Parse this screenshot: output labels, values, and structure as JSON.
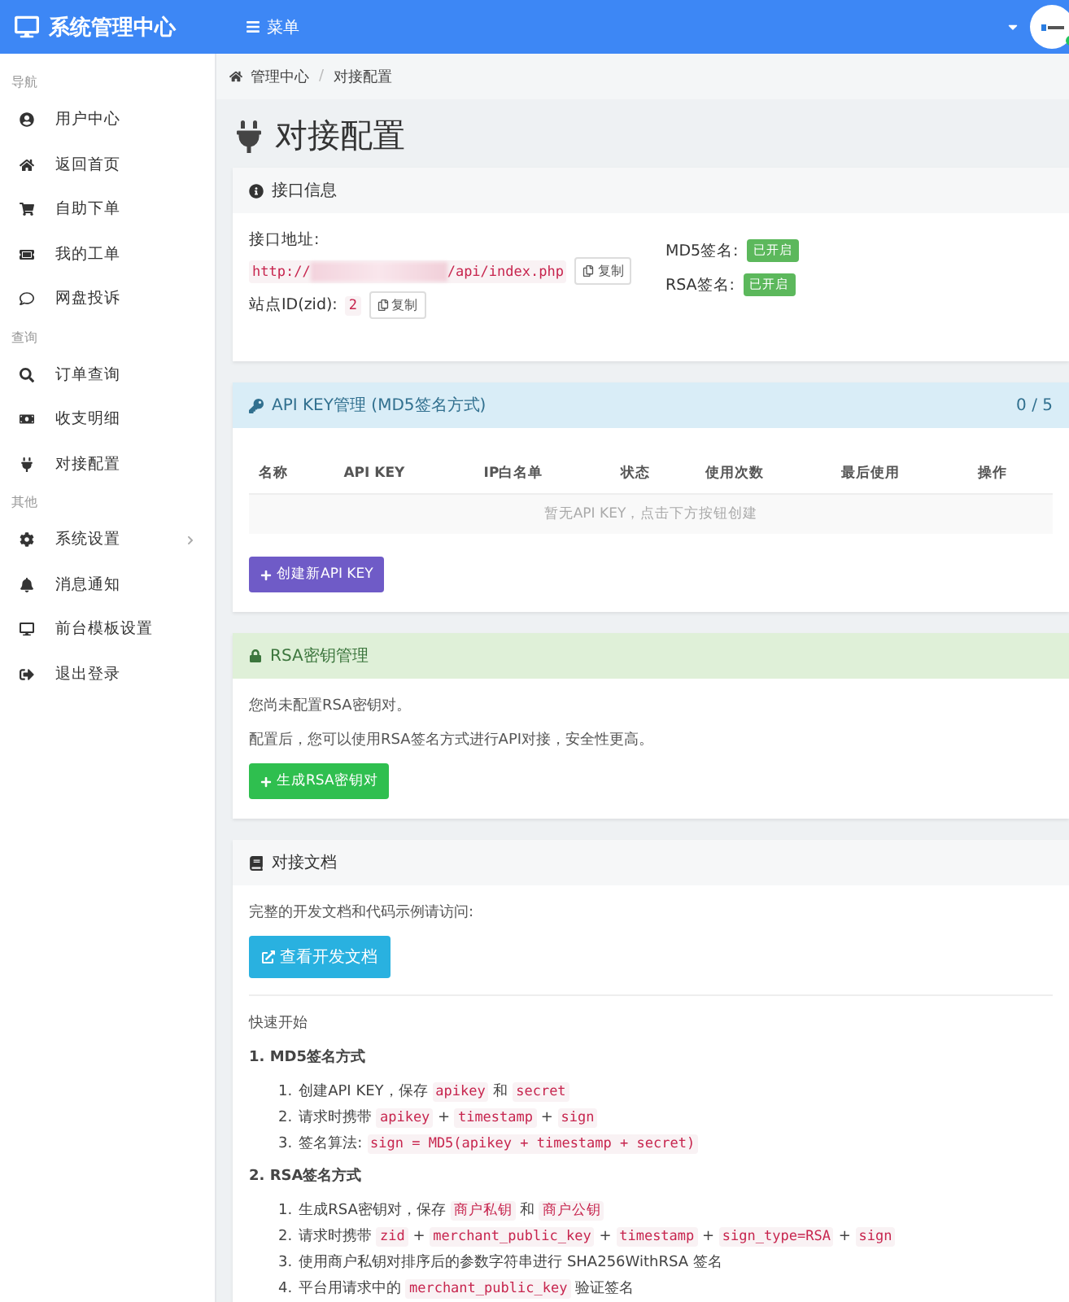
{
  "header": {
    "title": "系统管理中心",
    "menu_label": "菜单",
    "online": true
  },
  "sidebar": {
    "sections": [
      {
        "title": "导航",
        "items": [
          {
            "label": "用户中心"
          },
          {
            "label": "返回首页"
          },
          {
            "label": "自助下单"
          },
          {
            "label": "我的工单"
          },
          {
            "label": "网盘投诉"
          }
        ]
      },
      {
        "title": "查询",
        "items": [
          {
            "label": "订单查询"
          },
          {
            "label": "收支明细"
          },
          {
            "label": "对接配置"
          }
        ]
      },
      {
        "title": "其他",
        "items": [
          {
            "label": "系统设置",
            "expandable": true
          },
          {
            "label": "消息通知"
          },
          {
            "label": "前台模板设置"
          },
          {
            "label": "退出登录"
          }
        ]
      }
    ]
  },
  "breadcrumb": [
    "管理中心",
    "对接配置"
  ],
  "breadcrumb_separator": "/",
  "page_title": "对接配置",
  "interface_info": {
    "title": "接口信息",
    "url_label": "接口地址:",
    "url_prefix": "http://",
    "url_suffix": "/api/index.php",
    "copy_label": "复制",
    "zid_label": "站点ID(zid):",
    "zid": "2",
    "zid_copy_label": "复制",
    "signatures": [
      {
        "label": "MD5签名:",
        "status": "已开启",
        "enabled": true
      },
      {
        "label": "RSA签名:",
        "status": "已开启",
        "enabled": true
      }
    ]
  },
  "api_keys": {
    "title": "API KEY管理 (MD5签名方式)",
    "count": "0 / 5",
    "columns": [
      "名称",
      "API KEY",
      "IP白名单",
      "状态",
      "使用次数",
      "最后使用",
      "操作"
    ],
    "empty_message": "暂无API KEY，点击下方按钮创建",
    "button": "创建新API KEY"
  },
  "rsa": {
    "title": "RSA密钥管理",
    "lines": [
      "您尚未配置RSA密钥对。",
      "配置后，您可以使用RSA签名方式进行API对接，安全性更高。"
    ],
    "button": "生成RSA密钥对"
  },
  "docs": {
    "title": "对接文档",
    "intro": "完整的开发文档和代码示例请访问:",
    "button": "查看开发文档",
    "quick_start": "快速开始",
    "methods": [
      {
        "title": "1. MD5签名方式",
        "steps": [
          {
            "number": "1.",
            "parts": [
              {
                "text": "创建API KEY，保存 "
              },
              {
                "code": "apikey"
              },
              {
                "text": " 和 "
              },
              {
                "code": "secret"
              }
            ]
          },
          {
            "number": "2.",
            "parts": [
              {
                "text": "请求时携带 "
              },
              {
                "code": "apikey"
              },
              {
                "text": " + "
              },
              {
                "code": "timestamp"
              },
              {
                "text": " + "
              },
              {
                "code": "sign"
              }
            ]
          },
          {
            "number": "3.",
            "parts": [
              {
                "text": "签名算法: "
              },
              {
                "code": "sign = MD5(apikey + timestamp + secret)"
              }
            ]
          }
        ]
      },
      {
        "title": "2. RSA签名方式",
        "steps": [
          {
            "number": "1.",
            "parts": [
              {
                "text": "生成RSA密钥对，保存 "
              },
              {
                "code": "商户私钥"
              },
              {
                "text": " 和 "
              },
              {
                "code": "商户公钥"
              }
            ]
          },
          {
            "number": "2.",
            "parts": [
              {
                "text": "请求时携带 "
              },
              {
                "code": "zid"
              },
              {
                "text": " + "
              },
              {
                "code": "merchant_public_key"
              },
              {
                "text": " + "
              },
              {
                "code": "timestamp"
              },
              {
                "text": " + "
              },
              {
                "code": "sign_type=RSA"
              },
              {
                "text": " + "
              },
              {
                "code": "sign"
              }
            ]
          },
          {
            "number": "3.",
            "parts": [
              {
                "text": "使用商户私钥对排序后的参数字符串进行 SHA256WithRSA 签名"
              }
            ]
          },
          {
            "number": "4.",
            "parts": [
              {
                "text": "平台用请求中的 "
              },
              {
                "code": "merchant_public_key"
              },
              {
                "text": " 验证签名"
              }
            ]
          }
        ]
      }
    ]
  }
}
